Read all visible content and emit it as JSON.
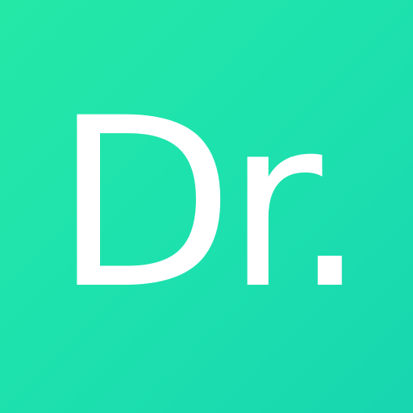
{
  "icon": {
    "text": "Dr.",
    "colors": {
      "background_start": "#24e8a6",
      "background_end": "#17d6b0",
      "text": "#ffffff"
    }
  }
}
